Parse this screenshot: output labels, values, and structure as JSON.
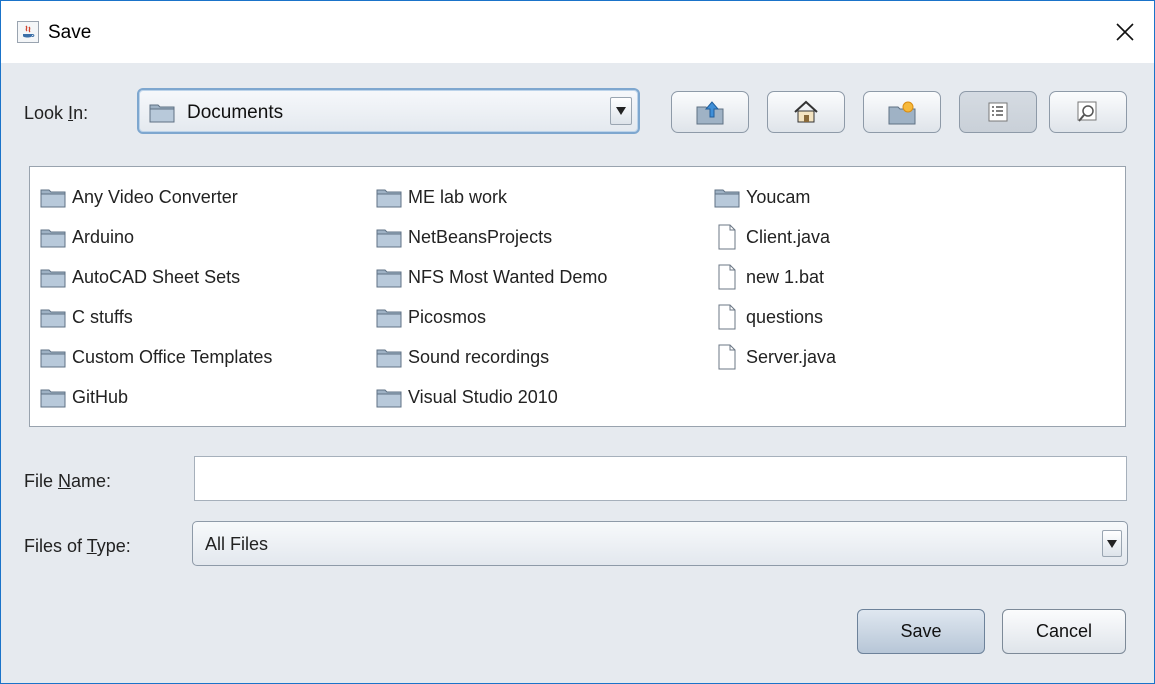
{
  "window": {
    "title": "Save"
  },
  "look_in": {
    "label_pre": "Look ",
    "label_mnemonic": "I",
    "label_post": "n:",
    "selected": "Documents"
  },
  "toolbar": {
    "buttons": [
      {
        "name": "up-one-level",
        "icon": "folder-up-icon"
      },
      {
        "name": "home",
        "icon": "home-icon"
      },
      {
        "name": "create-new-folder",
        "icon": "new-folder-icon"
      },
      {
        "name": "list-view",
        "icon": "list-view-icon",
        "pressed": true
      },
      {
        "name": "details-view",
        "icon": "details-view-icon"
      }
    ]
  },
  "files": {
    "column1": [
      {
        "name": "Any Video Converter",
        "type": "folder"
      },
      {
        "name": "Arduino",
        "type": "folder"
      },
      {
        "name": "AutoCAD Sheet Sets",
        "type": "folder"
      },
      {
        "name": "C stuffs",
        "type": "folder"
      },
      {
        "name": "Custom Office Templates",
        "type": "folder"
      },
      {
        "name": "GitHub",
        "type": "folder"
      }
    ],
    "column2": [
      {
        "name": "ME lab work",
        "type": "folder"
      },
      {
        "name": "NetBeansProjects",
        "type": "folder"
      },
      {
        "name": "NFS Most Wanted Demo",
        "type": "folder"
      },
      {
        "name": "Picosmos",
        "type": "folder"
      },
      {
        "name": "Sound recordings",
        "type": "folder"
      },
      {
        "name": "Visual Studio 2010",
        "type": "folder"
      }
    ],
    "column3": [
      {
        "name": "Youcam",
        "type": "folder"
      },
      {
        "name": "Client.java",
        "type": "file"
      },
      {
        "name": "new 1.bat",
        "type": "file"
      },
      {
        "name": "questions",
        "type": "file"
      },
      {
        "name": "Server.java",
        "type": "file"
      }
    ]
  },
  "file_name": {
    "label_pre": "File ",
    "label_mnemonic": "N",
    "label_post": "ame:",
    "value": ""
  },
  "file_type": {
    "label_pre": "Files of ",
    "label_mnemonic": "T",
    "label_post": "ype:",
    "selected": "All Files"
  },
  "actions": {
    "save": "Save",
    "cancel": "Cancel"
  }
}
